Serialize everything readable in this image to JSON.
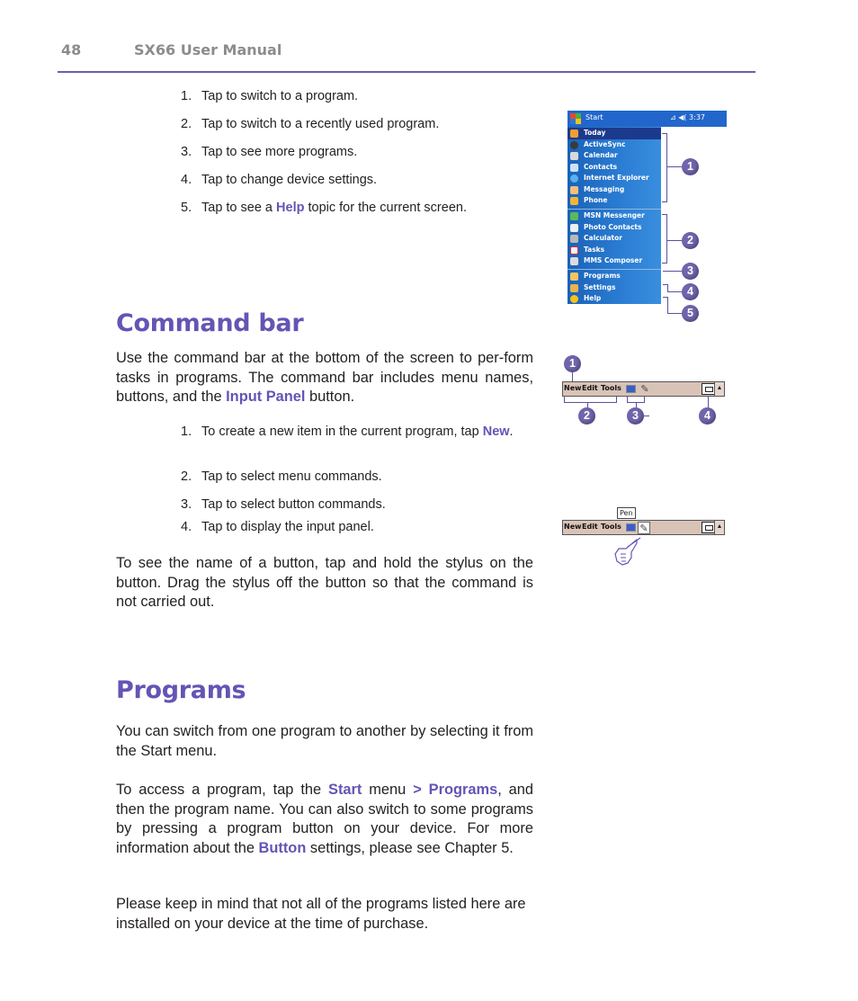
{
  "header": {
    "page_number": "48",
    "manual_title": "SX66 User Manual",
    "accent_color": "#6355b4"
  },
  "start_menu_callouts": [
    {
      "num": "1.",
      "text": "Tap to switch to a program."
    },
    {
      "num": "2.",
      "text": "Tap to switch to a recently used program."
    },
    {
      "num": "3.",
      "text": "Tap to see more programs."
    },
    {
      "num": "4.",
      "text": "Tap to change device settings."
    },
    {
      "num": "5.",
      "pre": "Tap to see a ",
      "highlight": "Help",
      "post": " topic for the current screen."
    }
  ],
  "start_menu_figure": {
    "title": "Start",
    "time": "3:37",
    "status_icons": [
      "signal-icon",
      "volume-icon"
    ],
    "group1": [
      "Today",
      "ActiveSync",
      "Calendar",
      "Contacts",
      "Internet Explorer",
      "Messaging",
      "Phone"
    ],
    "group2": [
      "MSN Messenger",
      "Photo Contacts",
      "Calculator",
      "Tasks",
      "MMS Composer"
    ],
    "group3": [
      "Programs",
      "Settings",
      "Help"
    ],
    "selected": "Today",
    "badges": [
      "1",
      "2",
      "3",
      "4",
      "5"
    ]
  },
  "command_bar_section": {
    "heading": "Command bar",
    "intro_pre": "Use the command bar at the bottom of the screen to per-form tasks in programs. The command bar includes menu names, buttons, and the ",
    "intro_highlight": "Input Panel",
    "intro_post": " button.",
    "callouts": [
      {
        "num": "1.",
        "pre": "To create a new item in the current program, tap ",
        "highlight": "New",
        "post": "."
      },
      {
        "num": "2.",
        "text": "Tap to select menu commands."
      },
      {
        "num": "3.",
        "text": "Tap to select button commands."
      },
      {
        "num": "4.",
        "text": "Tap to display the input panel."
      }
    ],
    "tip": "To see the name of a button, tap and hold the stylus on the button. Drag the stylus off the button so that the command is not carried out."
  },
  "command_bar_figure": {
    "menus": [
      "New",
      "Edit",
      "Tools"
    ],
    "tooltip": "Pen",
    "badges": [
      "1",
      "2",
      "3",
      "4"
    ]
  },
  "programs_section": {
    "heading": "Programs",
    "p1": "You can switch from one program to another by selecting it from the Start menu.",
    "p2_a": "To access a program, tap the ",
    "p2_start": "Start",
    "p2_b": " menu ",
    "p2_programs": "> Programs",
    "p2_c": ", and then the program name. You can also switch to some programs by pressing a program button on your device. For more information about the ",
    "p2_button": "Button",
    "p2_d": " settings, please see Chapter 5.",
    "p3": "Please keep in mind that not all of the programs listed here are installed on your device at the time of purchase."
  }
}
